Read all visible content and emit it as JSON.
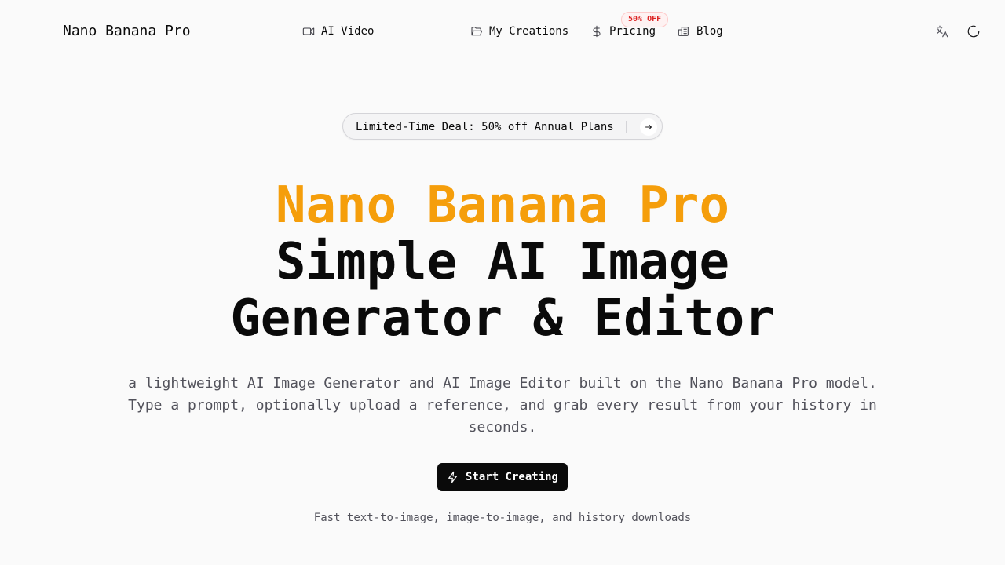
{
  "header": {
    "brand": "Nano Banana Pro",
    "nav": {
      "ai_video": "AI Video",
      "my_creations": "My Creations",
      "pricing": "Pricing",
      "pricing_badge": "50% OFF",
      "blog": "Blog"
    },
    "icons": {
      "ai_video": "video-camera-icon",
      "my_creations": "folder-open-icon",
      "pricing": "dollar-sign-icon",
      "blog": "newspaper-icon",
      "language": "translate-icon",
      "theme": "theme-toggle-icon"
    }
  },
  "deal": {
    "text": "Limited-Time Deal: 50% off Annual Plans",
    "icon": "arrow-right-icon"
  },
  "hero": {
    "title_line1": "Nano Banana Pro",
    "title_line2": "Simple AI Image",
    "title_line3": "Generator & Editor",
    "description": "a lightweight AI Image Generator and AI Image Editor built on the Nano Banana Pro model. Type a prompt, optionally upload a reference, and grab every result from your history in seconds.",
    "cta_label": "Start Creating",
    "cta_icon": "lightning-bolt-icon",
    "tagline": "Fast text-to-image, image-to-image, and history downloads"
  },
  "colors": {
    "accent": "#f59e0b",
    "badge_text": "#dc2626",
    "badge_bg": "#fef2f2",
    "cta_bg": "#0a0a0a",
    "background": "#fafafa"
  }
}
